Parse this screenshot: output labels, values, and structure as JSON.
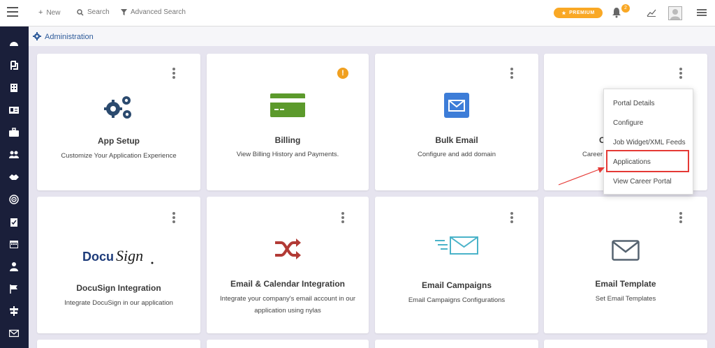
{
  "topbar": {
    "new_label": "New",
    "search_label": "Search",
    "advanced_search_label": "Advanced Search",
    "premium_label": "PREMIUM",
    "notification_count": "2"
  },
  "breadcrumb": {
    "title": "Administration"
  },
  "cards": [
    {
      "title": "App Setup",
      "desc": "Customize Your Application Experience",
      "icon": "gears-icon"
    },
    {
      "title": "Billing",
      "desc": "View Billing History and Payments.",
      "icon": "credit-card-icon"
    },
    {
      "title": "Bulk Email",
      "desc": "Configure and add domain",
      "icon": "envelope-icon"
    },
    {
      "title": "C",
      "desc": "Career",
      "icon": "career-portal-icon"
    },
    {
      "title": "DocuSign Integration",
      "desc": "Integrate DocuSign in our application",
      "icon": "docusign-logo"
    },
    {
      "title": "Email & Calendar Integration",
      "desc": "Integrate your company's email account in our application using nylas",
      "icon": "shuffle-icon"
    },
    {
      "title": "Email Campaigns",
      "desc": "Email Campaigns Configurations",
      "icon": "fast-mail-icon"
    },
    {
      "title": "Email Template",
      "desc": "Set Email Templates",
      "icon": "envelope-outline-icon"
    }
  ],
  "docusign_logo_text": "DocuSign",
  "dropdown": {
    "items": [
      "Portal Details",
      "Configure",
      "Job Widget/XML Feeds",
      "Applications",
      "View Career Portal"
    ]
  },
  "colors": {
    "accent": "#f9a825",
    "sidebar": "#1a1f3a",
    "link": "#2e5b9a",
    "highlight": "#e53935"
  }
}
